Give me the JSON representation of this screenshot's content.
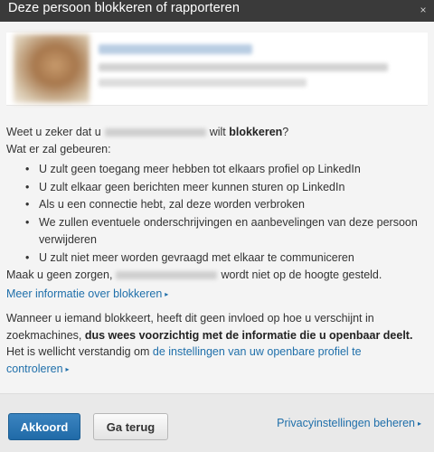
{
  "dialog": {
    "title": "Deze persoon blokkeren of rapporteren",
    "close_icon": "×"
  },
  "question": {
    "prefix": "Weet u zeker dat u",
    "middle": "wilt",
    "bold": "blokkeren",
    "end": "?"
  },
  "what_happens": "Wat er zal gebeuren:",
  "effects": [
    "U zult geen toegang meer hebben tot elkaars profiel op LinkedIn",
    "U zult elkaar geen berichten meer kunnen sturen op LinkedIn",
    "Als u een connectie hebt, zal deze worden verbroken",
    "We zullen eventuele onderschrijvingen en aanbevelingen van deze persoon verwijderen",
    "U zult niet meer worden gevraagd met elkaar te communiceren"
  ],
  "reassure": {
    "prefix": "Maak u geen zorgen,",
    "suffix": "wordt niet op de hoogte gesteld."
  },
  "more_info_link": "Meer informatie over blokkeren",
  "warning": {
    "text1": "Wanneer u iemand blokkeert, heeft dit geen invloed op hoe u verschijnt in zoekmachines,",
    "bold": "dus wees voorzichtig met de informatie die u openbaar deelt.",
    "text2": "Het is wellicht verstandig om",
    "link": "de instellingen van uw openbare profiel te controleren"
  },
  "footer": {
    "accept_label": "Akkoord",
    "back_label": "Ga terug",
    "privacy_link": "Privacyinstellingen beheren"
  },
  "arrow_glyph": "▸",
  "colors": {
    "titlebar": "#3a3a3a",
    "link": "#1f6faa",
    "primary_button": "#2c78b5",
    "background": "#f4f4f4"
  }
}
